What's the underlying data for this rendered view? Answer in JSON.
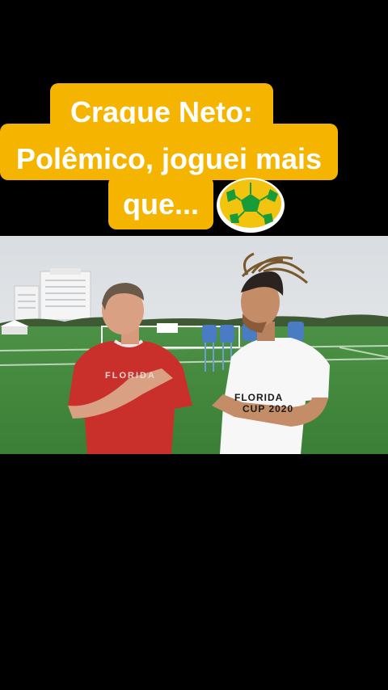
{
  "caption": {
    "line1": "Craque Neto:",
    "line2": "Polêmico, joguei mais",
    "line3": "que..."
  },
  "video": {
    "shirt_left": "FLORIDA",
    "shirt_right_line1": "FLORIDA",
    "shirt_right_line2": "CUP 2020"
  },
  "icons": {
    "ball": "soccer-ball-icon"
  },
  "colors": {
    "background": "#000000",
    "caption_bg": "#f5b400",
    "caption_text": "#ffffff",
    "field": "#3f8a3a",
    "red_shirt": "#c9302c"
  }
}
